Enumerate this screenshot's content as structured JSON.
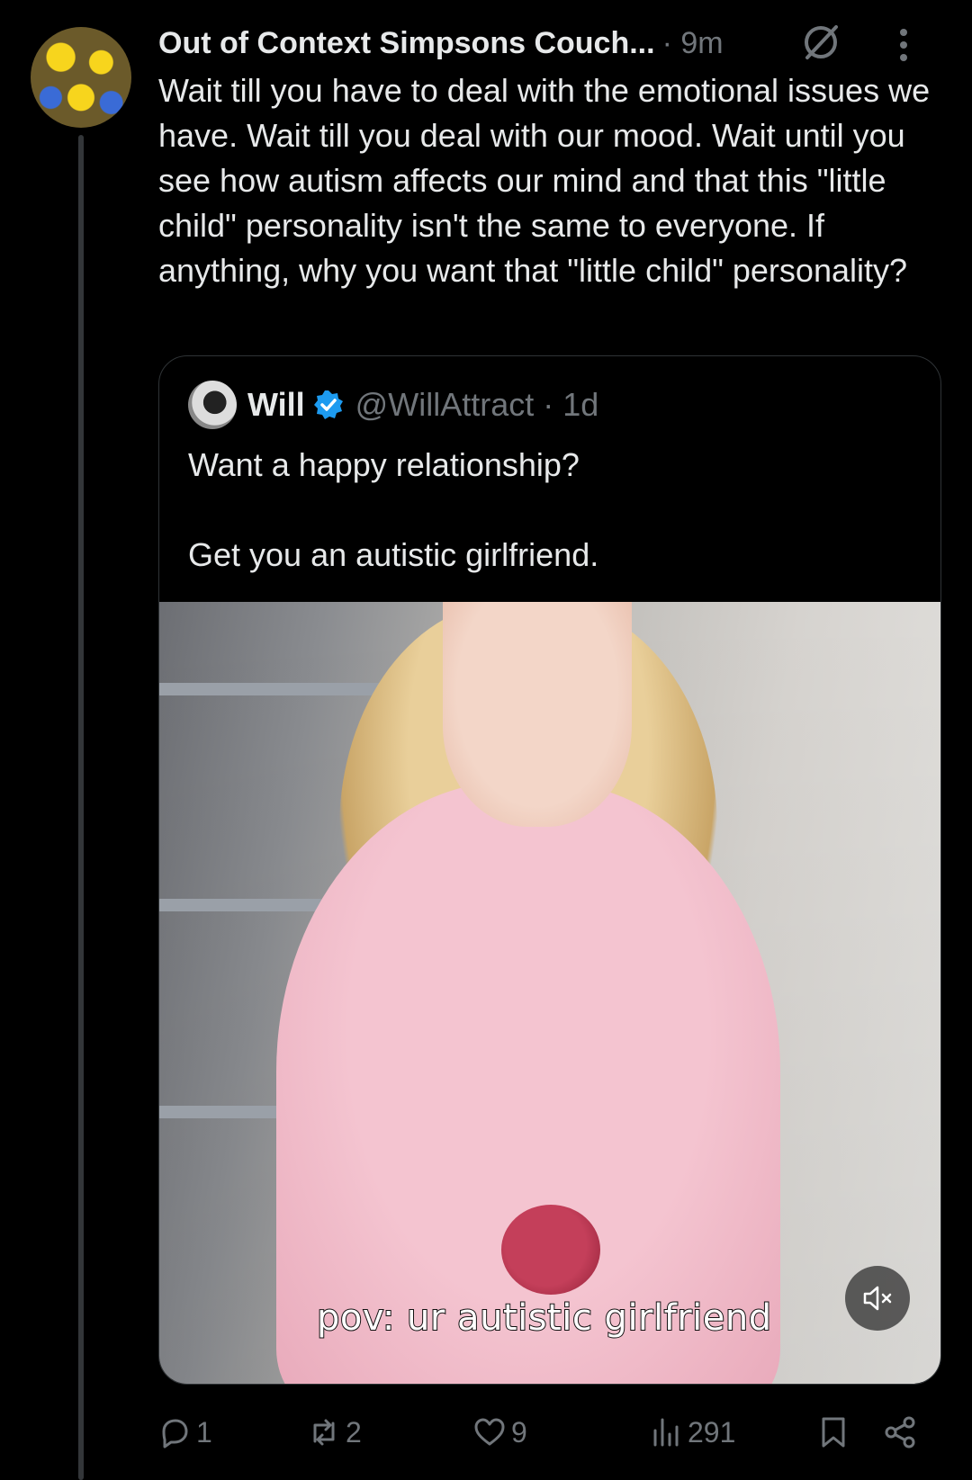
{
  "post": {
    "author": "Out of Context Simpsons Couch...",
    "time": "· 9m",
    "text": "Wait till you have to deal with the emotional issues we have. Wait till you deal with our mood. Wait until you see how autism affects our mind and that this \"little child\" personality isn't the same to everyone. If anything, why you want that \"little child\" personality?"
  },
  "quote": {
    "name": "Will",
    "handle": "@WillAttract · 1d",
    "text": "Want a happy relationship?\n\nGet you an autistic girlfriend.",
    "video_caption": "pov: ur autistic girlfriend"
  },
  "actions": {
    "replies": "1",
    "reposts": "2",
    "likes": "9",
    "views": "291"
  },
  "icons": {
    "grok": "grok-icon",
    "more": "more-vertical-icon",
    "verified": "verified-badge-icon",
    "mute": "volume-muted-icon",
    "reply": "reply-icon",
    "repost": "repost-icon",
    "like": "heart-icon",
    "views": "views-icon",
    "bookmark": "bookmark-icon",
    "share": "share-icon"
  },
  "colors": {
    "background": "#000000",
    "text": "#e7e9ea",
    "muted": "#71767b",
    "verified": "#1d9bf0",
    "border": "#2f3336"
  }
}
